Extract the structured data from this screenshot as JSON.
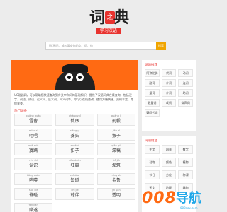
{
  "logo": {
    "char1": "词",
    "badge": "之",
    "char2": "典",
    "slogan": "学习汉语"
  },
  "search": {
    "placeholder": "UC图示：输入要查询的字、词、句",
    "button_label": "搜索"
  },
  "intro": {
    "text": "UC磁器网，可以帮助您快速查询到有关字和词的基础知识，提供了汉语词典在线查询，包括汉字、词语、成语、近义词、反义词、同义词等，你可以在线查询，使用方便快捷，资料丰富，等你来查。"
  },
  "hot_words": {
    "title": "热门词条",
    "items": [
      {
        "pinyin": "xuǎng guǎn",
        "word": "雪曹"
      },
      {
        "pinyin": "cháng zhǐ",
        "word": "倘序"
      },
      {
        "pinyin": "guǎng jī",
        "word": "刑毅"
      },
      {
        "pinyin": "miǎo xì",
        "word": "咀唱"
      },
      {
        "pinyin": "xiāng yì",
        "word": "菱头"
      },
      {
        "pinyin": "jiāo zǐ",
        "word": "猴子"
      },
      {
        "pinyin": "miè miè",
        "word": "寞蹒"
      },
      {
        "pinyin": "zhuǎ zǐ",
        "word": "扣子"
      },
      {
        "pinyin": "qiān gǔ",
        "word": "滞稿"
      },
      {
        "pinyin": "rěn shì",
        "word": "认识"
      },
      {
        "pinyin": "dǎo duàn",
        "word": "狂离"
      },
      {
        "pinyin": "tiě jiǎ",
        "word": "渥筑"
      },
      {
        "pinyin": "kōng xuān",
        "word": "呜噎"
      },
      {
        "pinyin": "zhī dào",
        "word": "知道"
      },
      {
        "pinyin": "míng shì",
        "word": "金鲁"
      },
      {
        "pinyin": "suō xiè",
        "word": "脊碰"
      },
      {
        "pinyin": "chí jiē",
        "word": "乾伴"
      },
      {
        "pinyin": "jǐn yán",
        "word": "透明"
      },
      {
        "pinyin": "fèn jiàn",
        "word": "赠遂"
      }
    ]
  },
  "side_recommend": {
    "title": "词语推荐",
    "items": [
      "阿弥陀佛",
      "代词",
      "动词",
      "副词",
      "介词",
      "连词",
      "量词",
      "介词",
      "助词",
      "数量词",
      "叹词",
      "拟声词",
      "疑问代词"
    ]
  },
  "side_category": {
    "title": "词语组合",
    "items": [
      "生字",
      "四季",
      "数字",
      "动物",
      "颜色",
      "植物",
      "节日",
      "方位",
      "称谓",
      "天文",
      "地理",
      "器物"
    ]
  },
  "watermark": {
    "num": "008",
    "nav": "导航",
    "url": "008nav.com"
  }
}
